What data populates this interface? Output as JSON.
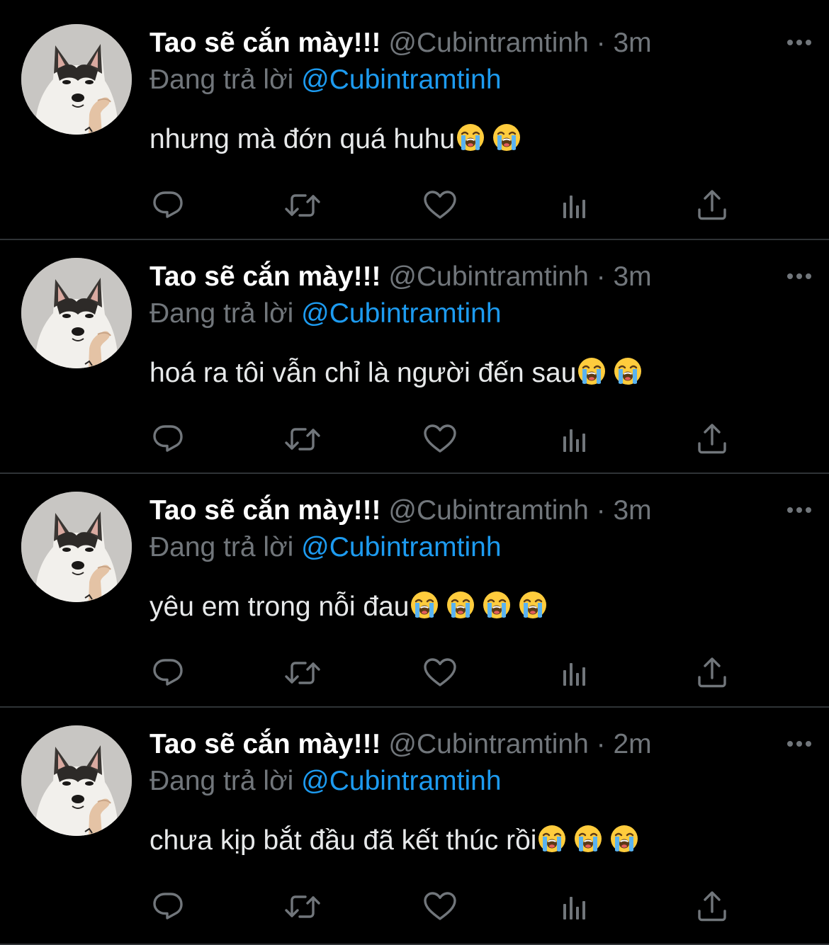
{
  "colors": {
    "background": "#000000",
    "text_primary": "#e7e9ea",
    "text_secondary": "#71767b",
    "accent": "#1d9bf0",
    "divider": "#2f3336"
  },
  "icons": {
    "reply": "reply-icon",
    "retweet": "retweet-icon",
    "like": "heart-icon",
    "views": "views-icon",
    "share": "share-icon",
    "more": "more-icon",
    "emoji": "loudly-crying-face-emoji"
  },
  "tweets": [
    {
      "display_name": "Tao sẽ cắn mày!!!",
      "handle": "@Cubintramtinh",
      "separator": "·",
      "time": "3m",
      "reply_prefix": "Đang trả lời",
      "reply_to": "@Cubintramtinh",
      "text": "nhưng mà đớn quá huhu",
      "emoji_count": 2
    },
    {
      "display_name": "Tao sẽ cắn mày!!!",
      "handle": "@Cubintramtinh",
      "separator": "·",
      "time": "3m",
      "reply_prefix": "Đang trả lời",
      "reply_to": "@Cubintramtinh",
      "text": "hoá ra tôi vẫn chỉ là người đến sau",
      "emoji_count": 2
    },
    {
      "display_name": "Tao sẽ cắn mày!!!",
      "handle": "@Cubintramtinh",
      "separator": "·",
      "time": "3m",
      "reply_prefix": "Đang trả lời",
      "reply_to": "@Cubintramtinh",
      "text": "yêu em trong nỗi đau",
      "emoji_count": 4
    },
    {
      "display_name": "Tao sẽ cắn mày!!!",
      "handle": "@Cubintramtinh",
      "separator": "·",
      "time": "2m",
      "reply_prefix": "Đang trả lời",
      "reply_to": "@Cubintramtinh",
      "text": "chưa kịp bắt đầu đã kết thúc rồi",
      "emoji_count": 3
    }
  ]
}
